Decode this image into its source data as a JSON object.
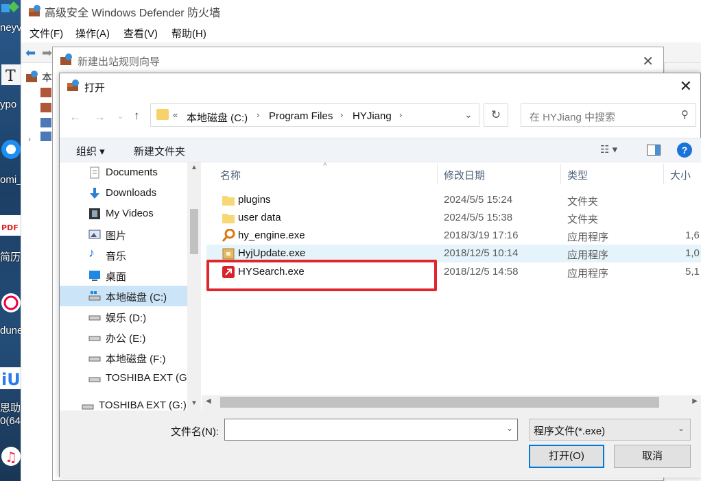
{
  "desktop": {
    "labels": [
      "neyv",
      "ypo",
      "omi_",
      "简历",
      "dune",
      "思助",
      "0(64"
    ]
  },
  "defender": {
    "title": "高级安全 Windows Defender 防火墙",
    "menus": [
      "文件(F)",
      "操作(A)",
      "查看(V)",
      "帮助(H)"
    ],
    "tree_label": "本"
  },
  "wizard": {
    "title": "新建出站规则向导"
  },
  "dialog": {
    "title": "打开",
    "breadcrumb": [
      "本地磁盘 (C:)",
      "Program Files",
      "HYJiang"
    ],
    "breadcrumb_prefix": "«",
    "search_placeholder": "在 HYJiang 中搜索",
    "toolbar": {
      "organize": "组织 ▾",
      "new_folder": "新建文件夹"
    },
    "nav_items": [
      {
        "label": "Documents",
        "icon": "documents-icon"
      },
      {
        "label": "Downloads",
        "icon": "downloads-icon"
      },
      {
        "label": "My Videos",
        "icon": "videos-icon"
      },
      {
        "label": "图片",
        "icon": "pictures-icon"
      },
      {
        "label": "音乐",
        "icon": "music-icon"
      },
      {
        "label": "桌面",
        "icon": "desktop-icon"
      },
      {
        "label": "本地磁盘 (C:)",
        "icon": "drive-c-icon",
        "selected": true
      },
      {
        "label": "娱乐 (D:)",
        "icon": "drive-icon"
      },
      {
        "label": "办公 (E:)",
        "icon": "drive-icon"
      },
      {
        "label": "本地磁盘 (F:)",
        "icon": "drive-icon"
      },
      {
        "label": "TOSHIBA EXT (G:)",
        "icon": "drive-icon"
      },
      {
        "label": "TOSHIBA EXT (G:)",
        "icon": "drive-icon"
      }
    ],
    "columns": {
      "name": "名称",
      "date": "修改日期",
      "type": "类型",
      "size": "大小"
    },
    "files": [
      {
        "name": "plugins",
        "date": "2024/5/5 15:24",
        "type": "文件夹",
        "size": "",
        "icon": "folder-icon"
      },
      {
        "name": "user data",
        "date": "2024/5/5 15:38",
        "type": "文件夹",
        "size": "",
        "icon": "folder-icon"
      },
      {
        "name": "hy_engine.exe",
        "date": "2018/3/19 17:16",
        "type": "应用程序",
        "size": "1,6",
        "icon": "key-app-icon"
      },
      {
        "name": "HyjUpdate.exe",
        "date": "2018/12/5 10:14",
        "type": "应用程序",
        "size": "1,0",
        "icon": "installer-icon"
      },
      {
        "name": "HYSearch.exe",
        "date": "2018/12/5 14:58",
        "type": "应用程序",
        "size": "5,1",
        "icon": "hysearch-app-icon"
      }
    ],
    "filename_label": "文件名(N):",
    "filename_value": "",
    "filetype": "程序文件(*.exe)",
    "open_button": "打开(O)",
    "cancel_button": "取消"
  },
  "colors": {
    "highlight_box": "#e0262d",
    "selected_nav": "#cce4f7",
    "focus_border": "#0078d7"
  }
}
